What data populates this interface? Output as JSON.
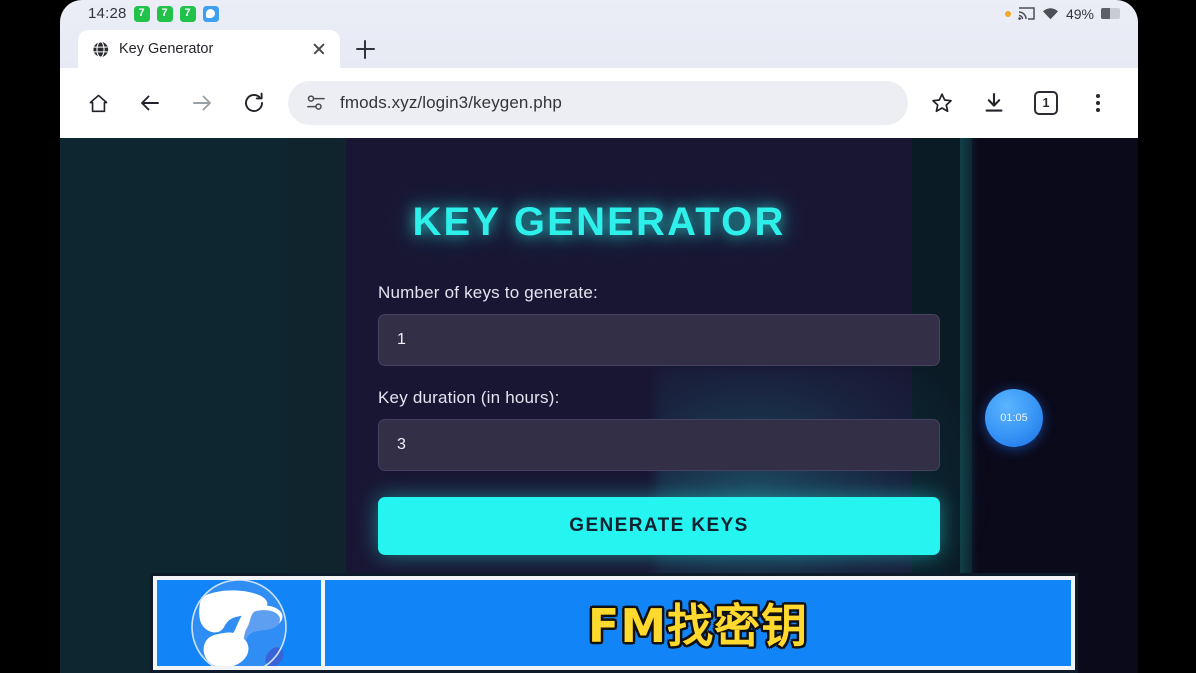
{
  "status_bar": {
    "time": "14:28",
    "app_icons": [
      {
        "name": "app-icon-green-1",
        "glyph": "7",
        "color": "#21c24a"
      },
      {
        "name": "app-icon-green-2",
        "glyph": "7",
        "color": "#21c24a"
      },
      {
        "name": "app-icon-green-3",
        "glyph": "7",
        "color": "#21c24a"
      },
      {
        "name": "app-icon-blue-chat",
        "glyph": "",
        "color": "#3ea0ef"
      }
    ],
    "battery_percent": "49%",
    "icons": [
      "notification-dot",
      "cast-icon",
      "wifi-icon",
      "battery-icon"
    ]
  },
  "browser": {
    "tab": {
      "title": "Key Generator",
      "favicon": "globe-icon",
      "close_icon": "close-icon"
    },
    "new_tab_icon": "plus-icon",
    "toolbar": {
      "home_icon": "home-icon",
      "back_icon": "back-arrow-icon",
      "forward_icon": "forward-arrow-icon",
      "reload_icon": "reload-icon",
      "site_info_icon": "page-info-icon",
      "url": "fmods.xyz/login3/keygen.php",
      "bookmark_icon": "star-icon",
      "download_icon": "download-icon",
      "tab_count": "1",
      "menu_icon": "kebab-menu-icon"
    }
  },
  "page": {
    "title": "KEY GENERATOR",
    "fields": [
      {
        "label": "Number of keys to generate:",
        "value": "1",
        "name": "number-of-keys-input"
      },
      {
        "label": "Key duration (in hours):",
        "value": "3",
        "name": "key-duration-input"
      }
    ],
    "generate_button": "GENERATE KEYS",
    "timer_bubble": "01:05",
    "colors": {
      "accent_cyan": "#25f4f0",
      "title_cyan": "#2df0ea",
      "card_bg": "#191633",
      "input_bg": "#332f47",
      "timer_blue": "#3d9bf7"
    }
  },
  "banner": {
    "logo": "globe-logo",
    "text": "FM找密钥",
    "bg_color": "#1184f7",
    "text_color": "#ffd92e"
  }
}
